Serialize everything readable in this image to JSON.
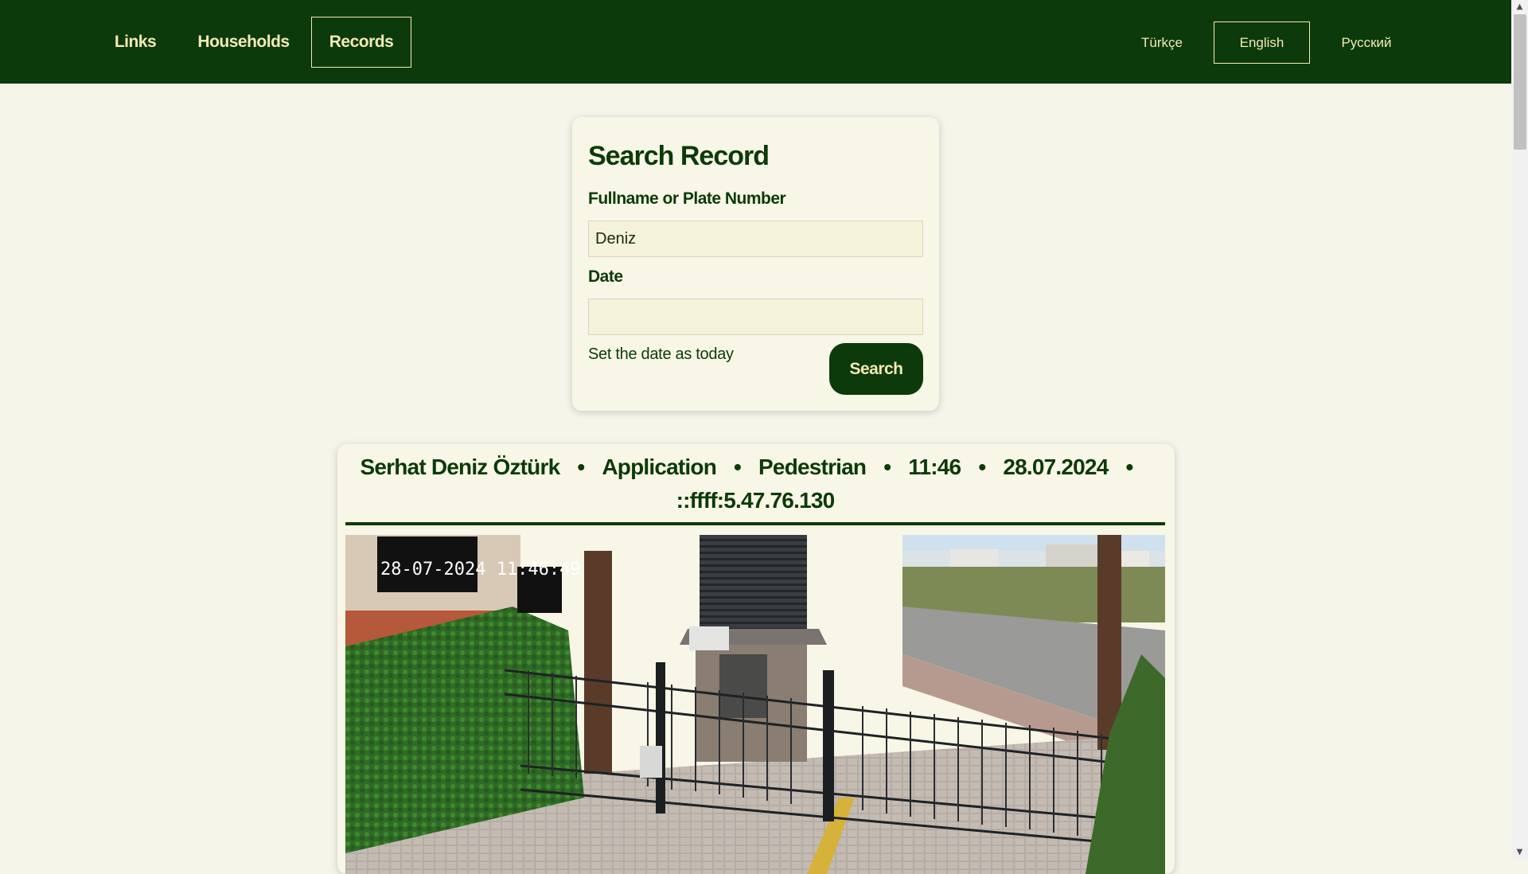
{
  "nav": {
    "links": "Links",
    "households": "Households",
    "records": "Records"
  },
  "languages": {
    "turkish": "Türkçe",
    "english": "English",
    "russian": "Русский"
  },
  "search": {
    "title": "Search Record",
    "name_label": "Fullname or Plate Number",
    "name_value": "Deniz",
    "date_label": "Date",
    "date_value": "",
    "today_link": "Set the date as today",
    "button": "Search"
  },
  "record": {
    "name": "Serhat Deniz Öztürk",
    "source": "Application",
    "type": "Pedestrian",
    "time": "11:46",
    "date": "28.07.2024",
    "ip": "::ffff:5.47.76.130",
    "separator": "•",
    "camera_timestamp": "28-07-2024 11:46:49"
  },
  "colors": {
    "primary": "#0c3a0a",
    "accent": "#f4e9b6",
    "background": "#f6f5ea"
  }
}
